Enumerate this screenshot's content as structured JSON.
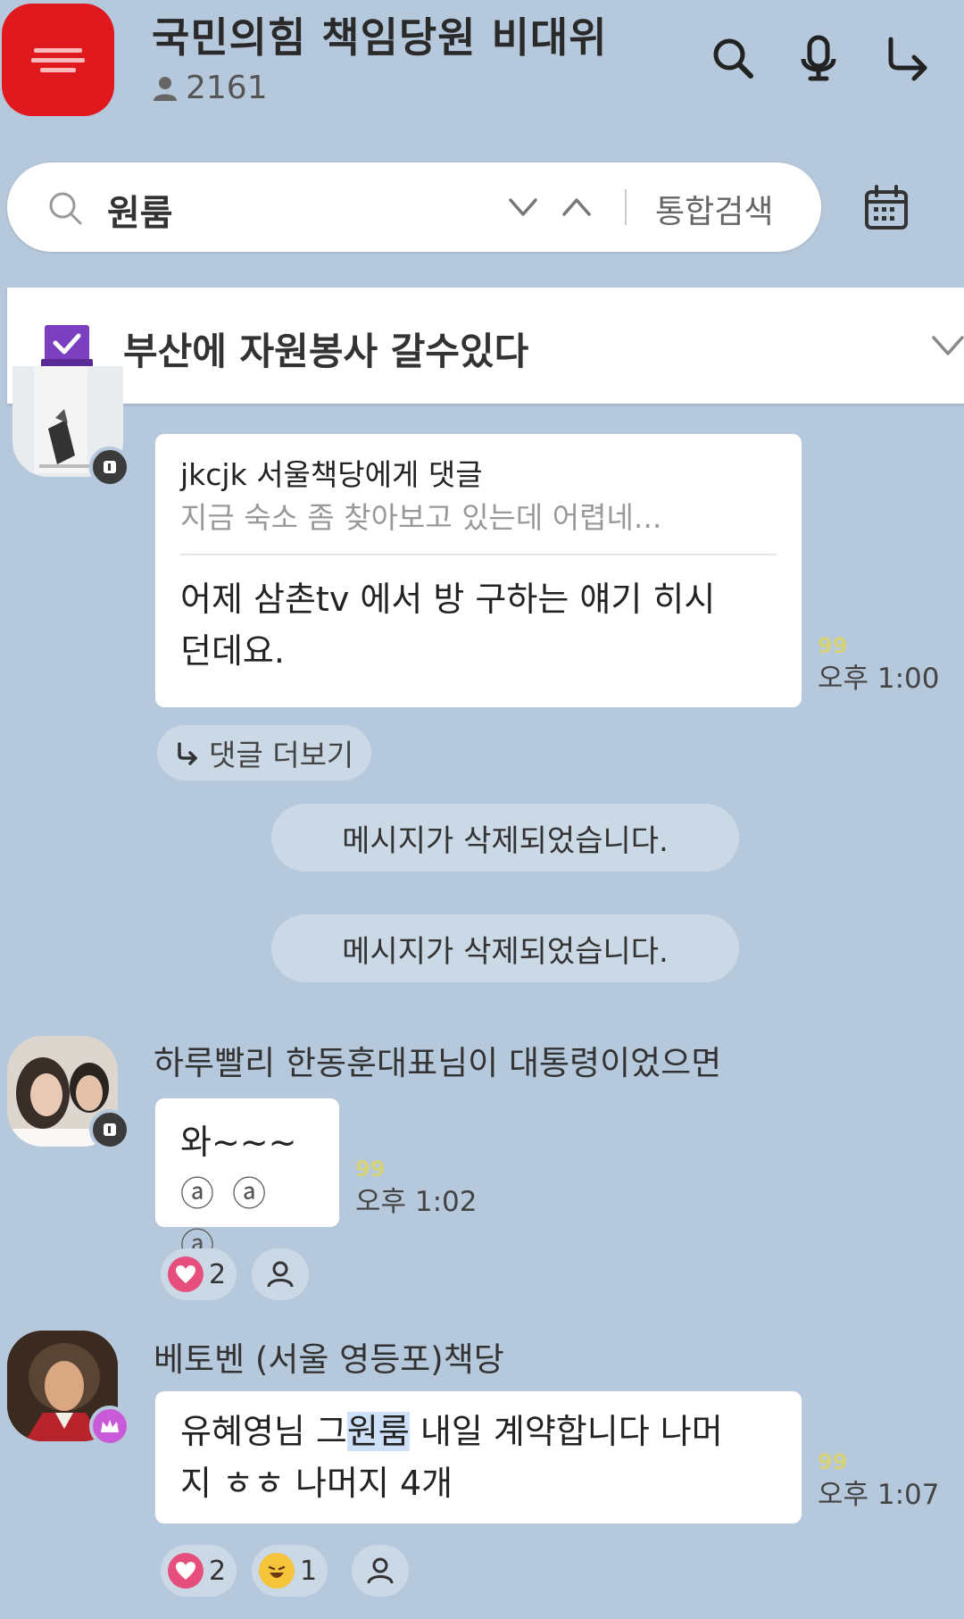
{
  "header": {
    "room_title": "국민의힘 책임당원 비대위",
    "member_count": "2161",
    "icons": [
      "search-icon",
      "microphone-icon",
      "share-icon"
    ]
  },
  "search": {
    "query": "원룸",
    "scope_label": "통합검색"
  },
  "notice": {
    "text": "부산에 자원봉사 갈수있다"
  },
  "messages": [
    {
      "reply_target": "jkcjk 서울책당에게 댓글",
      "reply_quote": "지금 숙소 좀 찾아보고 있는데 어렵네...",
      "text_line1": "어제  삼촌tv 에서 방 구하는 얘기  히시",
      "text_line2": "던데요.",
      "quote_mark": "99",
      "time": "오후 1:00",
      "more_replies": "댓글 더보기"
    },
    {
      "deleted_text": "메시지가 삭제되었습니다."
    },
    {
      "deleted_text": "메시지가 삭제되었습니다."
    },
    {
      "sender": "하루빨리 한동훈대표님이 대통령이었으면",
      "text_line1": "와~~~",
      "text_line2": "ⓐ ⓐ ⓐ",
      "quote_mark": "99",
      "time": "오후 1:02",
      "reactions": [
        {
          "type": "heart",
          "count": "2"
        }
      ]
    },
    {
      "sender": "베토벤 (서울 영등포)책당",
      "text_line1_pre": "유혜영님 그",
      "text_line1_hl": "원룸",
      "text_line1_post": " 내일 계약합니다 나머",
      "text_line2": "지 ㅎㅎ 나머지 4개",
      "quote_mark": "99",
      "time": "오후 1:07",
      "reactions": [
        {
          "type": "heart",
          "count": "2"
        },
        {
          "type": "laugh",
          "count": "1"
        }
      ]
    }
  ],
  "colors": {
    "background": "#b6c8dc",
    "logo_red": "#e0191f",
    "notice_check": "#7b3fbf",
    "heart": "#e64f7c",
    "highlight": "#cde0f7"
  }
}
